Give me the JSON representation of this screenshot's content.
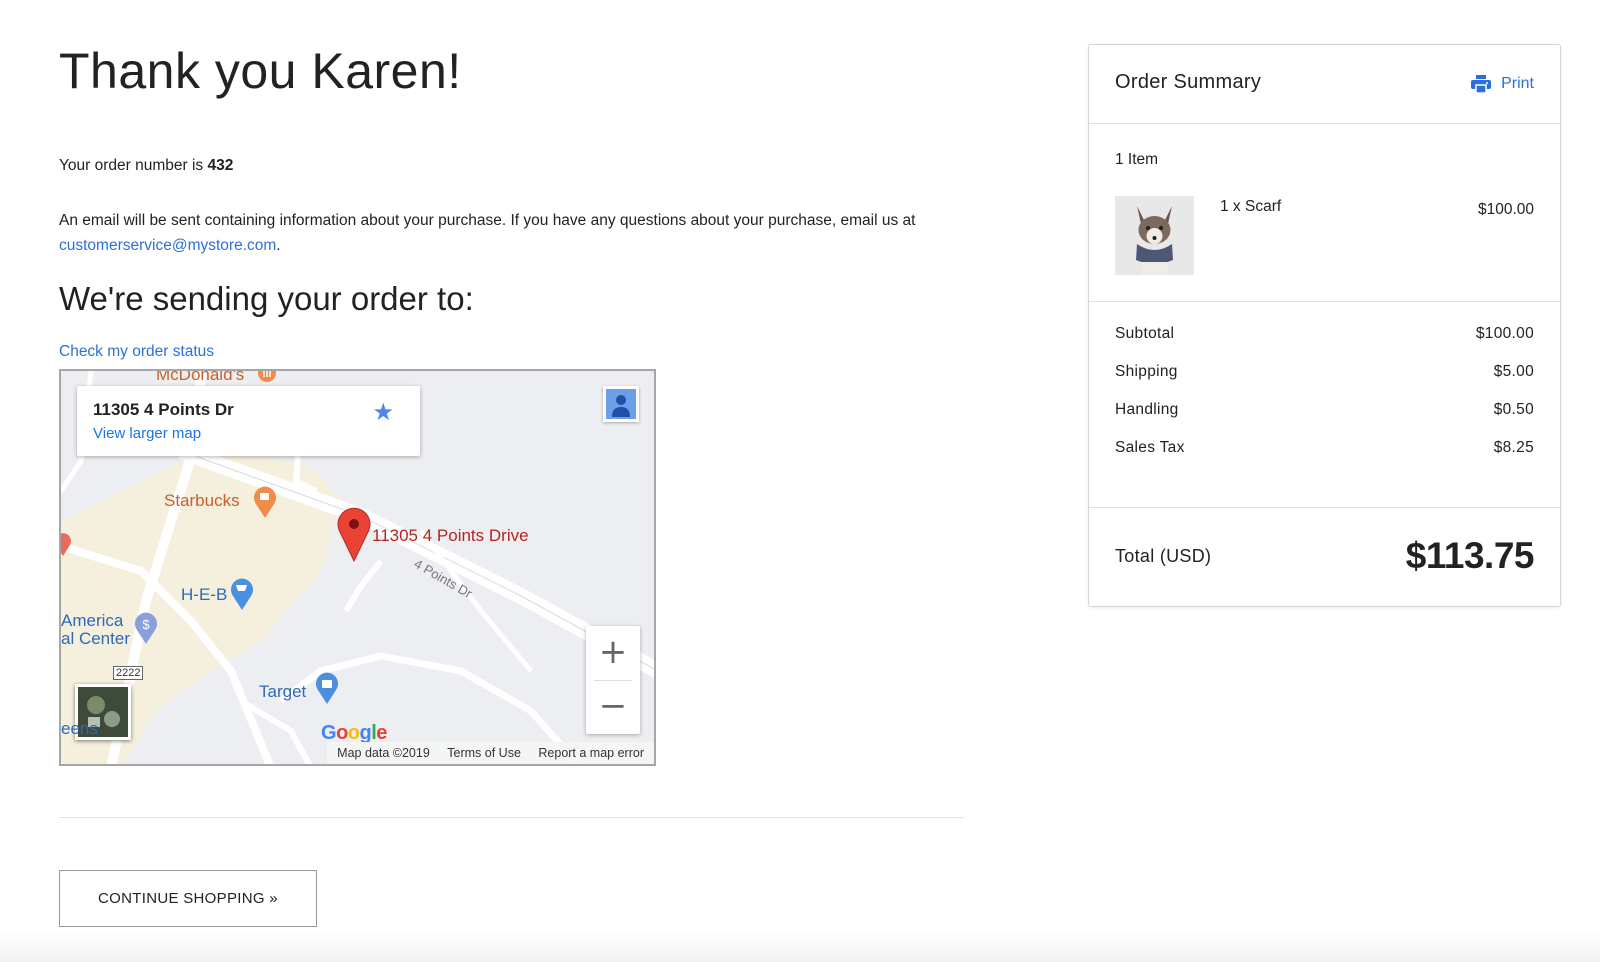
{
  "main": {
    "heading": "Thank you Karen!",
    "order_number_prefix": "Your order number is ",
    "order_number": "432",
    "email_text": "An email will be sent containing information about your purchase. If you have any questions about your purchase, email us at ",
    "email_link": "customerservice@mystore.com",
    "email_suffix": ".",
    "sending_heading": "We're sending your order to:",
    "status_link": "Check my order status",
    "continue_button": "CONTINUE SHOPPING »"
  },
  "map": {
    "card_address": "11305 4 Points Dr",
    "card_link": "View larger map",
    "marker_label": "11305 4 Points Drive",
    "road_label": "4 Points Dr",
    "pois": {
      "mcdonalds": "McDonald's",
      "starbucks": "Starbucks",
      "heb": "H-E-B",
      "america_1": "America",
      "america_2": "al Center",
      "target": "Target",
      "eens": "eens",
      "route": "2222"
    },
    "google": "Google",
    "attribution": {
      "data": "Map data ©2019",
      "terms": "Terms of Use",
      "report": "Report a map error"
    },
    "zoom_in": "+",
    "zoom_out": "−"
  },
  "summary": {
    "title": "Order Summary",
    "print": "Print",
    "item_count": "1 Item",
    "item": {
      "name": "1 x Scarf",
      "price": "$100.00"
    },
    "lines": [
      {
        "label": "Subtotal",
        "value": "$100.00"
      },
      {
        "label": "Shipping",
        "value": "$5.00"
      },
      {
        "label": "Handling",
        "value": "$0.50"
      },
      {
        "label": "Sales Tax",
        "value": "$8.25"
      }
    ],
    "total_label": "Total (USD)",
    "total_value": "$113.75"
  },
  "colors": {
    "link": "#2d6fd8",
    "map_bg": "#eceef1",
    "map_land": "#f5efdd",
    "marker": "#ea4335"
  },
  "icons": [
    "printer-icon",
    "star-icon",
    "street-view-icon",
    "map-marker-icon",
    "zoom-in-icon",
    "zoom-out-icon",
    "satellite-thumbnail"
  ]
}
